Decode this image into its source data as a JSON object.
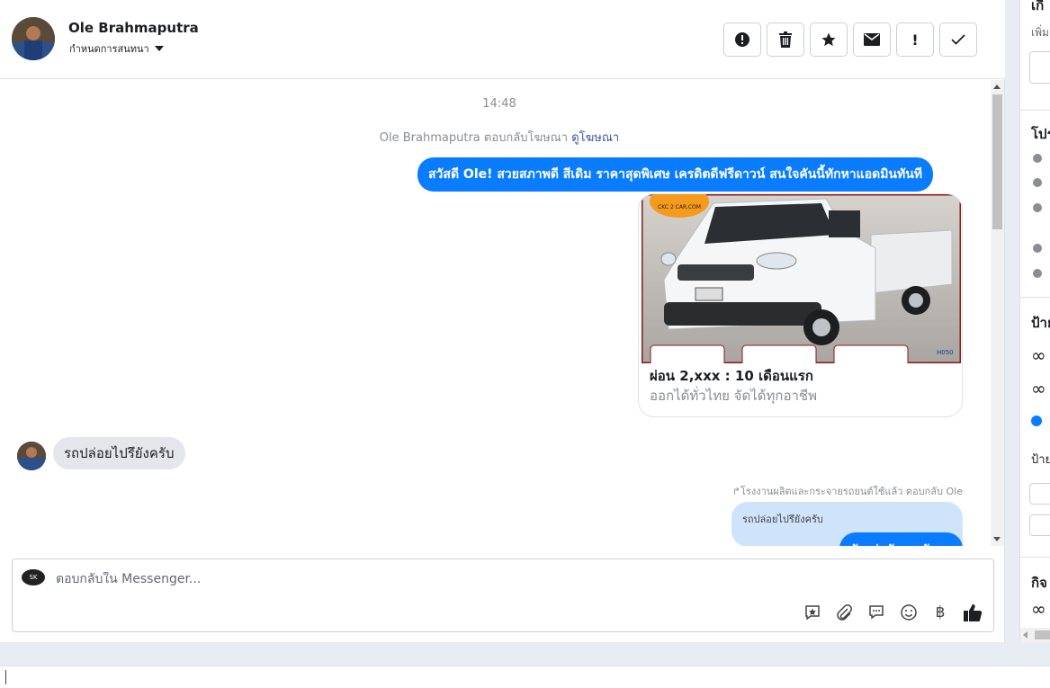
{
  "header": {
    "contact_name": "Ole Brahmaputra",
    "assign_label": "กำหนดการสนทนา",
    "actions": [
      {
        "name": "report-spam-button",
        "icon": "alert-circle-icon"
      },
      {
        "name": "delete-button",
        "icon": "trash-icon"
      },
      {
        "name": "star-button",
        "icon": "star-icon"
      },
      {
        "name": "mark-unread-button",
        "icon": "envelope-icon"
      },
      {
        "name": "mark-important-button",
        "icon": "exclamation-icon"
      },
      {
        "name": "mark-done-button",
        "icon": "check-icon"
      }
    ]
  },
  "messages": {
    "timestamp": "14:48",
    "ad_reply_prefix": "Ole Brahmaputra ตอบกลับโฆษณา",
    "ad_link": "ดูโฆษณา",
    "outgoing_1": "สวัสดี Ole! สวยสภาพดี สีเดิม ราคาสุดพิเศษ เครดิตดีฟรีดาวน์  สนใจคันนี้ทักหาแอดมินทันที",
    "card": {
      "logo_text": "CKC 2 CAR.COM",
      "stock_code": "H050",
      "title": "ผ่อน 2,xxx : 10 เดือนแรก",
      "subtitle": "ออกได้ทั่วไทย จัดได้ทุกอาชีพ"
    },
    "incoming_1": "รถปล่อยไปรึยังครับ",
    "reply_meta": "โรงงานผลิตและกระจายรถยนต์ใช้แล้ว ตอบกลับ Ole",
    "quoted_text": "รถปล่อยไปรึยังครับ",
    "outgoing_2_partial": "ยังอยู่ครับเอาตัว"
  },
  "composer": {
    "placeholder": "ตอบกลับใน Messenger...",
    "page_logo": "SK",
    "tools": [
      "saved-reply-icon",
      "attach-icon",
      "chat-bubble-icon",
      "emoji-icon",
      "baht-icon",
      "thumbs-up-icon"
    ]
  },
  "right_panel": {
    "title_partial": "เกี่",
    "add_partial": "เพิ่ม",
    "profile_partial": "โปร",
    "labels_partial": "ป้าย",
    "labels2_partial": "ป้าย",
    "activity_partial": "กิจ"
  },
  "colors": {
    "accent": "#0a7cff",
    "bubble_in": "#e4e6eb",
    "quoted": "#cfe3fb"
  }
}
